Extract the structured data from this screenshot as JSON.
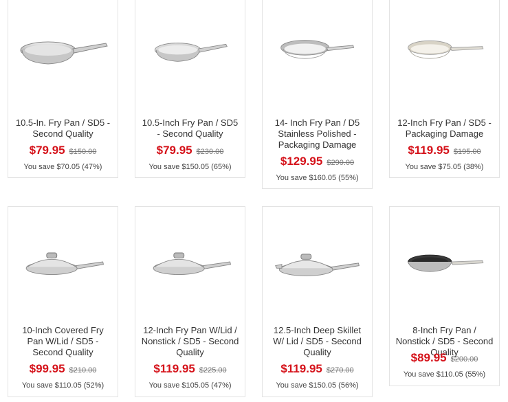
{
  "products": [
    {
      "title": "10.5-In. Fry Pan / SD5 - Second Quality",
      "price": "$79.95",
      "original_price": "$150.00",
      "savings": "You save $70.05 (47%)",
      "image": "stainless-fry-pan"
    },
    {
      "title": "10.5-Inch Fry Pan / SD5 - Second Quality",
      "price": "$79.95",
      "original_price": "$230.00",
      "savings": "You save $150.05 (65%)",
      "image": "stainless-fry-pan"
    },
    {
      "title": "14- Inch Fry Pan / D5 Stainless Polished - Packaging Damage",
      "price": "$129.95",
      "original_price": "$290.00",
      "savings": "You save $160.05 (55%)",
      "image": "stainless-fry-pan"
    },
    {
      "title": "12-Inch Fry Pan / SD5 - Packaging Damage",
      "price": "$119.95",
      "original_price": "$195.00",
      "savings": "You save $75.05 (38%)",
      "image": "stainless-fry-pan"
    },
    {
      "title": "10-Inch Covered Fry Pan W/Lid / SD5 - Second Quality",
      "price": "$99.95",
      "original_price": "$210.00",
      "savings": "You save $110.05 (52%)",
      "image": "covered-fry-pan"
    },
    {
      "title": "12-Inch Fry Pan W/Lid / Nonstick / SD5 - Second Quality",
      "price": "$119.95",
      "original_price": "$225.00",
      "savings": "You save $105.05 (47%)",
      "image": "covered-fry-pan"
    },
    {
      "title": "12.5-Inch Deep Skillet W/ Lid / SD5 - Second Quality",
      "price": "$119.95",
      "original_price": "$270.00",
      "savings": "You save $150.05 (56%)",
      "image": "covered-deep-skillet"
    },
    {
      "title": "8-Inch Fry Pan / Nonstick / SD5 - Second Quality",
      "price": "$89.95",
      "original_price": "$200.00",
      "savings": "You save $110.05 (55%)",
      "image": "nonstick-fry-pan"
    }
  ],
  "colors": {
    "sale_price": "#d5121a",
    "original_price": "#777777",
    "card_border": "#e3e3e3"
  }
}
